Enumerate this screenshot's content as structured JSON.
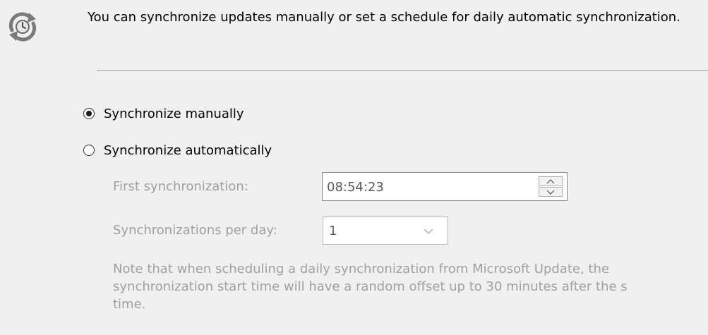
{
  "icon": "sync-clock-icon",
  "intro_text": "You can synchronize updates manually or set a schedule for daily automatic synchronization.",
  "options": {
    "manual": {
      "label": "Synchronize manually",
      "selected": true
    },
    "automatic": {
      "label": "Synchronize automatically",
      "selected": false
    }
  },
  "first_sync": {
    "label": "First synchronization:",
    "value": "08:54:23",
    "spinner_up_icon": "chevron-up-icon",
    "spinner_down_icon": "chevron-down-icon"
  },
  "per_day": {
    "label": "Synchronizations per day:",
    "value": "1",
    "dropdown_icon": "chevron-down-icon"
  },
  "note": {
    "lines": [
      "Note that when scheduling a daily synchronization from Microsoft Update, the",
      "synchronization start time will have a random offset up to 30 minutes after the s",
      "time."
    ]
  },
  "colors": {
    "background": "#f0f0f0",
    "disabled_text": "#a0a0a0",
    "divider": "#a0a0a0"
  }
}
